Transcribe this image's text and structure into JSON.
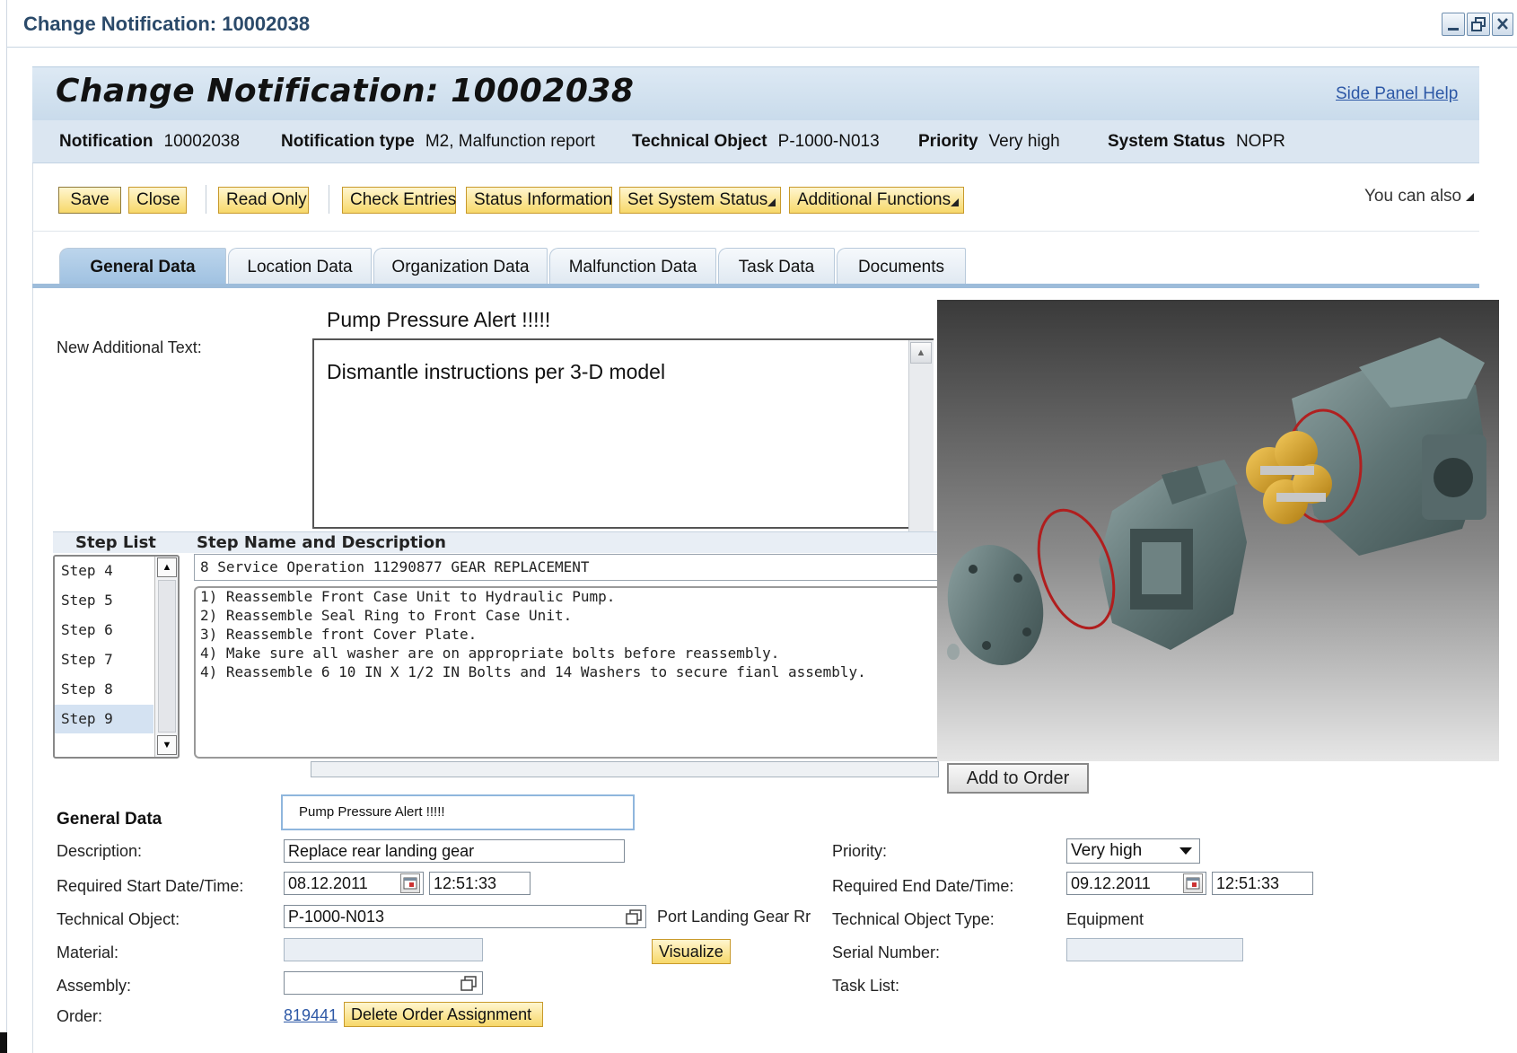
{
  "window": {
    "title": "Change Notification: 10002038",
    "controls": [
      "minimize-icon",
      "restore-icon",
      "close-icon"
    ]
  },
  "header": {
    "title": "Change Notification: 10002038",
    "side_panel_link": "Side Panel",
    "help_link": "Help"
  },
  "info_bar": {
    "notification_label": "Notification",
    "notification_value": "10002038",
    "type_label": "Notification type",
    "type_value": "M2, Malfunction report",
    "tech_object_label": "Technical Object",
    "tech_object_value": "P-1000-N013",
    "priority_label": "Priority",
    "priority_value": "Very high",
    "system_status_label": "System Status",
    "system_status_value": "NOPR"
  },
  "toolbar": {
    "save": "Save",
    "close": "Close",
    "read_only": "Read Only",
    "check_entries": "Check Entries",
    "status_information": "Status Information",
    "set_system_status": "Set System Status",
    "additional_functions": "Additional Functions",
    "you_can_also": "You can also"
  },
  "tabs": [
    {
      "label": "General Data",
      "active": true
    },
    {
      "label": "Location Data",
      "active": false
    },
    {
      "label": "Organization Data",
      "active": false
    },
    {
      "label": "Malfunction Data",
      "active": false
    },
    {
      "label": "Task Data",
      "active": false
    },
    {
      "label": "Documents",
      "active": false
    }
  ],
  "free_text": {
    "subject": "Pump Pressure Alert !!!!!",
    "label": "New Additional Text:",
    "body": "Dismantle instructions per 3-D model"
  },
  "steps": {
    "list_heading": "Step List",
    "name_heading": "Step Name and Description",
    "items": [
      "Step 4",
      "Step 5",
      "Step 6",
      "Step 7",
      "Step 8",
      "Step 9"
    ],
    "selected": "Step 9",
    "step_name": "8 Service Operation 11290877 GEAR REPLACEMENT",
    "description": [
      "1) Reassemble Front Case Unit to Hydraulic Pump.",
      "2) Reassemble Seal Ring to Front Case Unit.",
      "3) Reassemble front Cover Plate.",
      "4) Make sure all washer are on appropriate bolts before reassembly.",
      "4) Reassemble 6 10 IN X 1/2 IN Bolts and 14 Washers to secure fianl assembly."
    ]
  },
  "model_viewer": {
    "add_to_order": "Add to Order"
  },
  "general_data": {
    "heading": "General Data",
    "short_text": "Pump Pressure Alert !!!!!",
    "description_label": "Description:",
    "description_value": "Replace rear landing gear",
    "start_label": "Required Start Date/Time:",
    "start_date": "08.12.2011",
    "start_time": "12:51:33",
    "tech_object_label": "Technical Object:",
    "tech_object_value": "P-1000-N013",
    "tech_object_desc": "Port Landing Gear Rr",
    "material_label": "Material:",
    "visualize": "Visualize",
    "assembly_label": "Assembly:",
    "order_label": "Order:",
    "order_value": "819441",
    "delete_order_assignment": "Delete Order Assignment",
    "priority_label": "Priority:",
    "priority_value": "Very high",
    "end_label": "Required End Date/Time:",
    "end_date": "09.12.2011",
    "end_time": "12:51:33",
    "tech_object_type_label": "Technical Object Type:",
    "tech_object_type_value": "Equipment",
    "serial_label": "Serial Number:",
    "task_list_label": "Task List:"
  },
  "colors": {
    "accent_blue": "#2d58a6",
    "title_blue": "#2b4a6a",
    "button_yellow": "#f7d86a",
    "header_band": "#c9dbeb"
  }
}
